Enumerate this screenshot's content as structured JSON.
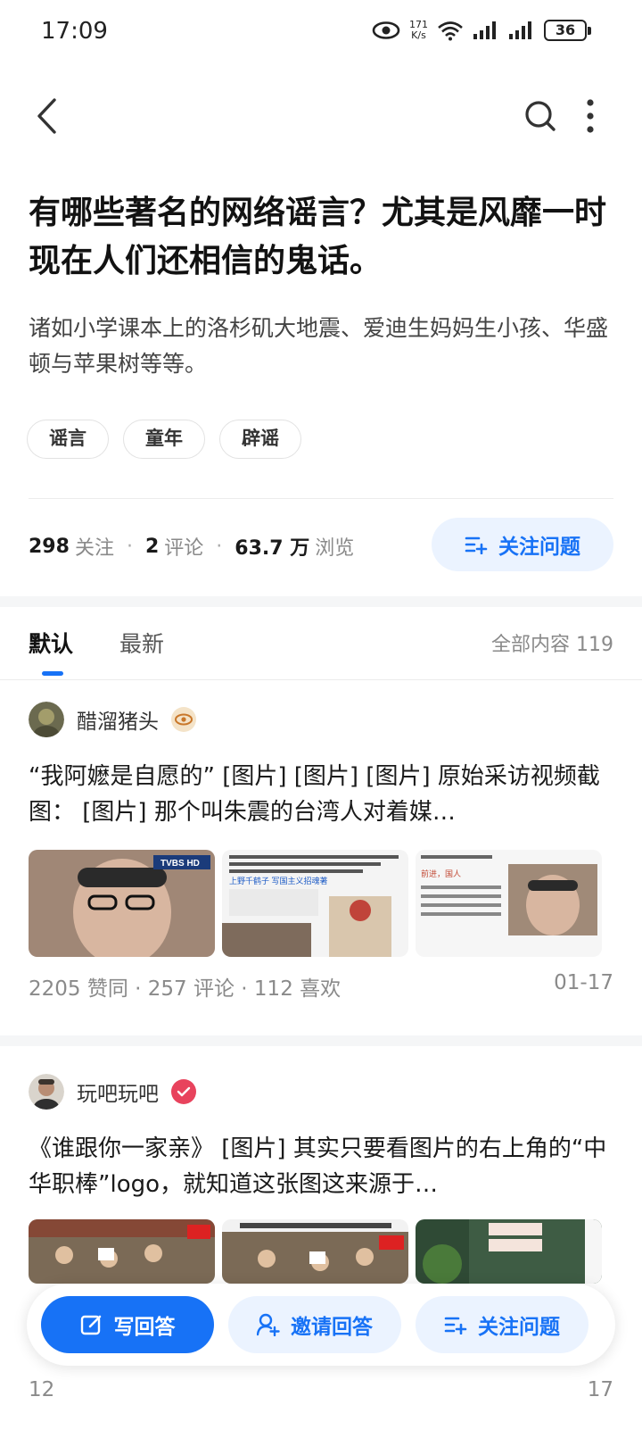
{
  "status_bar": {
    "time": "17:09",
    "net_speed_value": "171",
    "net_speed_unit": "K/s",
    "battery": "36",
    "icons": [
      "eye-icon",
      "wifi-icon",
      "signal-icon",
      "signal-icon",
      "battery-icon"
    ]
  },
  "nav": {
    "back_icon": "chevron-left-icon",
    "search_icon": "search-icon",
    "more_icon": "more-vertical-icon"
  },
  "question": {
    "title": "有哪些著名的网络谣言？尤其是风靡一时现在人们还相信的鬼话。",
    "description": "诸如小学课本上的洛杉矶大地震、爱迪生妈妈生小孩、华盛顿与苹果树等等。",
    "tags": [
      "谣言",
      "童年",
      "辟谣"
    ]
  },
  "stats": {
    "followers_count": "298",
    "followers_label": "关注",
    "comments_count": "2",
    "comments_label": "评论",
    "views_count": "63.7 万",
    "views_label": "浏览",
    "follow_button": "关注问题"
  },
  "tabs": {
    "items": [
      {
        "label": "默认",
        "active": true
      },
      {
        "label": "最新",
        "active": false
      }
    ],
    "all_content": "全部内容 119"
  },
  "answers": [
    {
      "author": "醋溜猪头",
      "excerpt": "“我阿嬷是自愿的” [图片] [图片] [图片] 原始采访视频截图： [图片] 那个叫朱震的台湾人对着媒…",
      "meta": "2205 赞同 · 257 评论 · 112 喜欢",
      "date": "01-17",
      "thumb_texts": [
        "TVBS HD",
        "上野千鹤子 写国主义招魂著",
        "前进，国人"
      ]
    },
    {
      "author": "玩吧玩吧",
      "excerpt": "《谁跟你一家亲》 [图片] 其实只要看图片的右上角的“中华职棒”logo，就知道这张图这来源于…",
      "meta": "12",
      "date": "17"
    }
  ],
  "bottom_bar": {
    "write": "写回答",
    "invite": "邀请回答",
    "follow": "关注问题"
  },
  "colors": {
    "accent": "#1772f6",
    "accent_light": "#ebf3ff",
    "text_secondary": "#8a8a8a"
  }
}
